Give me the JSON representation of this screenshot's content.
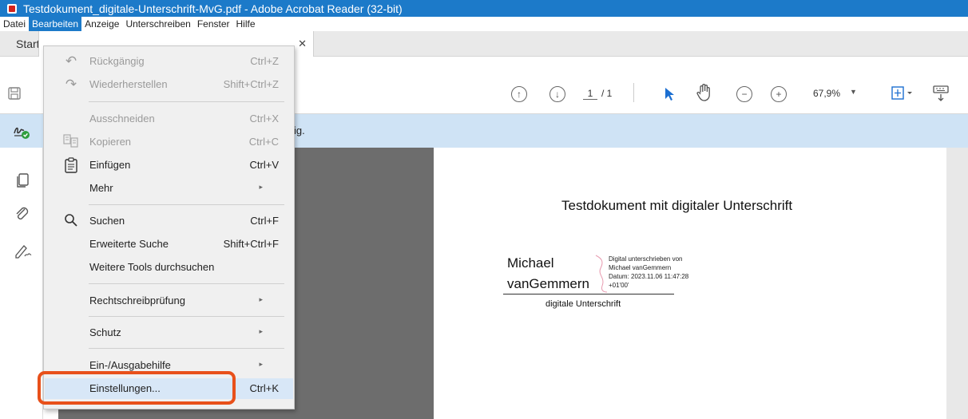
{
  "window": {
    "title": "Testdokument_digitale-Unterschrift-MvG.pdf - Adobe Acrobat Reader (32-bit)"
  },
  "menubar": [
    "Datei",
    "Bearbeiten",
    "Anzeige",
    "Unterschreiben",
    "Fenster",
    "Hilfe"
  ],
  "tabs": {
    "start": "Start"
  },
  "toolbar": {
    "page_current": "1",
    "page_total": "/ 1",
    "zoom": "67,9%"
  },
  "signature_bar": {
    "text_fragment": "ig."
  },
  "menu": {
    "items": [
      {
        "label": "Rückgängig",
        "shortcut": "Ctrl+Z",
        "disabled": true,
        "icon": "undo-icon"
      },
      {
        "label": "Wiederherstellen",
        "shortcut": "Shift+Ctrl+Z",
        "disabled": true,
        "icon": "redo-icon"
      },
      {
        "label": "Ausschneiden",
        "shortcut": "Ctrl+X",
        "disabled": true
      },
      {
        "label": "Kopieren",
        "shortcut": "Ctrl+C",
        "disabled": true,
        "icon": "copy-icon"
      },
      {
        "label": "Einfügen",
        "shortcut": "Ctrl+V",
        "disabled": false,
        "icon": "paste-icon"
      },
      {
        "label": "Mehr",
        "submenu": true
      },
      {
        "label": "Suchen",
        "shortcut": "Ctrl+F",
        "icon": "search-icon"
      },
      {
        "label": "Erweiterte Suche",
        "shortcut": "Shift+Ctrl+F"
      },
      {
        "label": "Weitere Tools durchsuchen"
      },
      {
        "label": "Rechtschreibprüfung",
        "submenu": true
      },
      {
        "label": "Schutz",
        "submenu": true
      },
      {
        "label": "Ein-/Ausgabehilfe",
        "submenu": true
      },
      {
        "label": "Einstellungen...",
        "shortcut": "Ctrl+K",
        "highlighted": true
      }
    ],
    "submenu_arrow": "▸"
  },
  "document": {
    "title": "Testdokument mit digitaler Unterschrift",
    "signer_line1": "Michael",
    "signer_line2": "vanGemmern",
    "sig_details": [
      "Digital unterschrieben von",
      "Michael vanGemmern",
      "Datum: 2023.11.06 11:47:28",
      "+01'00'"
    ],
    "caption": "digitale Unterschrift"
  },
  "colors": {
    "titlebar": "#1c7ac9",
    "highlight_box": "#e8501a",
    "signature_bar": "#cfe3f5"
  }
}
